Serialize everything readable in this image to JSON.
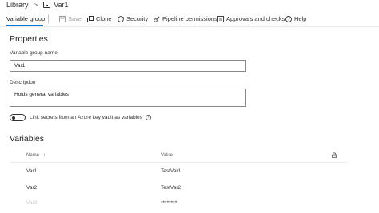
{
  "breadcrumb": {
    "root": "Library",
    "separator": ">",
    "current": "Var1"
  },
  "toolbar": {
    "tab_label": "Variable group",
    "save_label": "Save",
    "clone_label": "Clone",
    "security_label": "Security",
    "pipeline_permissions_label": "Pipeline permissions",
    "approvals_label": "Approvals and checks",
    "help_label": "Help"
  },
  "properties": {
    "heading": "Properties",
    "name_label": "Variable group name",
    "name_value": "Var1",
    "description_label": "Description",
    "description_value": "Holds general variables",
    "keyvault_toggle_label": "Link secrets from an Azure key vault as variables",
    "keyvault_toggle_on": false
  },
  "variables": {
    "heading": "Variables",
    "columns": {
      "name": "Name",
      "sort_glyph": "↑",
      "value": "Value"
    },
    "rows": [
      {
        "name": "Var1",
        "value": "TestVar1"
      },
      {
        "name": "Var2",
        "value": "TestVar2"
      },
      {
        "name": "Var3",
        "value": "********"
      }
    ]
  },
  "colors": {
    "accent": "#0078d4",
    "text": "#201f1e",
    "muted": "#605e5c",
    "disabled": "#a19f9d"
  }
}
